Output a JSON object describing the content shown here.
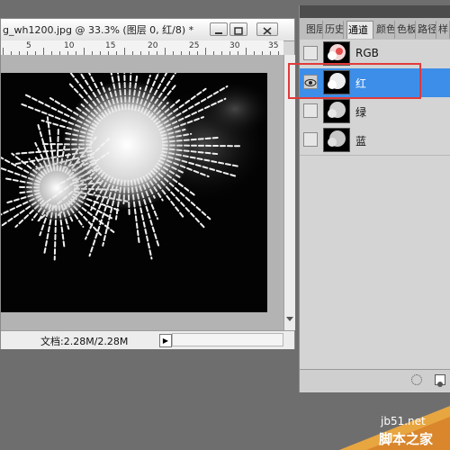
{
  "document": {
    "title": "g_wh1200.jpg @ 33.3% (图层 0, 红/8) *",
    "ruler_labels": [
      "5",
      "10",
      "15",
      "20",
      "25",
      "30",
      "35"
    ],
    "status_text": "文档:2.28M/2.28M",
    "status_arrow": "▶"
  },
  "panel": {
    "tabs": [
      "图层",
      "历史",
      "通道",
      "颜色",
      "色板",
      "路径",
      "样"
    ],
    "active_tab": "通道",
    "channels": [
      {
        "name": "RGB",
        "visible": false,
        "selected": false
      },
      {
        "name": "红",
        "visible": true,
        "selected": true
      },
      {
        "name": "绿",
        "visible": false,
        "selected": false
      },
      {
        "name": "蓝",
        "visible": false,
        "selected": false
      }
    ]
  },
  "highlight_color": "#e23a3a",
  "selection_color": "#3d8ee8",
  "watermark": {
    "url": "jb51.net",
    "text": "脚本之家"
  }
}
